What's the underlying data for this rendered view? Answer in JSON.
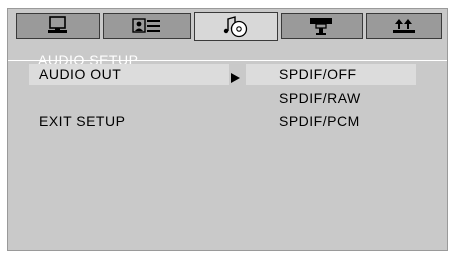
{
  "tabs": [
    {
      "icon": "monitor-icon"
    },
    {
      "icon": "language-icon"
    },
    {
      "icon": "audio-disc-icon"
    },
    {
      "icon": "video-camera-icon"
    },
    {
      "icon": "preference-arrows-icon"
    }
  ],
  "active_tab": 2,
  "menu": {
    "title": "AUDIO SETUP",
    "items": [
      {
        "label": "AUDIO OUT"
      },
      {
        "label": "EXIT SETUP"
      }
    ],
    "submenu_arrow": "play-arrow-icon",
    "options": [
      {
        "label": "SPDIF/OFF",
        "selected": true
      },
      {
        "label": "SPDIF/RAW"
      },
      {
        "label": "SPDIF/PCM"
      }
    ]
  },
  "colors": {
    "panel": "#c9c9c9",
    "tab": "#9a9a9a",
    "tab_active": "#d8d8d8",
    "highlight": "#dcdcdc",
    "title_text": "#ffffff"
  }
}
